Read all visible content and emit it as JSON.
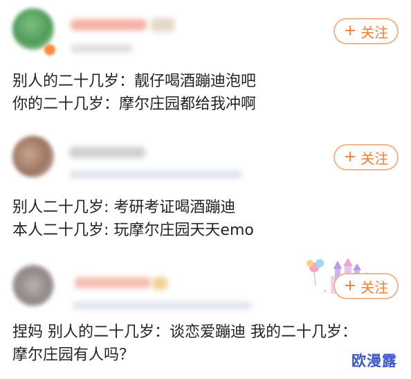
{
  "posts": [
    {
      "follow_label": "关注",
      "follow_icon": "plus-icon",
      "comment_lines": [
        "别人的二十几岁：靓仔喝酒蹦迪泡吧",
        "你的二十几岁：摩尔庄园都给我冲啊"
      ]
    },
    {
      "follow_label": "关注",
      "follow_icon": "plus-icon",
      "comment_lines": [
        "别人二十几岁: 考研考证喝酒蹦迪",
        "本人二十几岁: 玩摩尔庄园天天emo"
      ]
    },
    {
      "follow_label": "关注",
      "follow_icon": "plus-icon",
      "comment_lines": [
        "捏妈 别人的二十几岁：谈恋爱蹦迪 我的二十几岁：",
        "摩尔庄园有人吗？"
      ]
    }
  ],
  "watermark": "欧漫露",
  "accent_color": "#ff7a2f"
}
